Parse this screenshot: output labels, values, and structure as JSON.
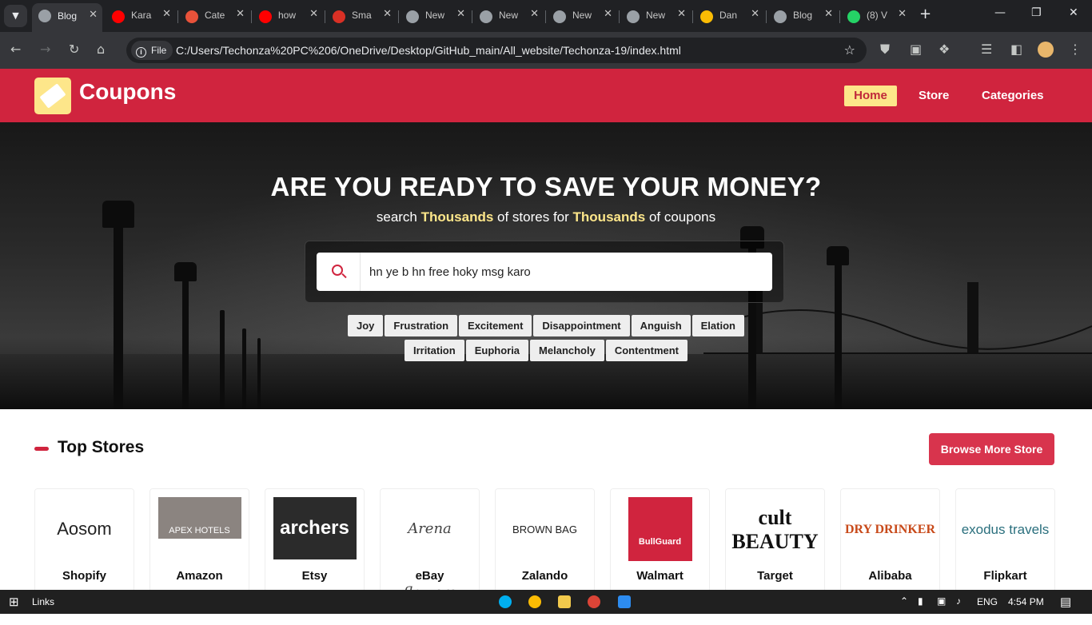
{
  "browser": {
    "tabs": [
      {
        "title": "Blog",
        "active": true,
        "color": "#9aa0a6"
      },
      {
        "title": "Kara",
        "active": false,
        "color": "#ff0000"
      },
      {
        "title": "Cate",
        "active": false,
        "color": "#e8523a"
      },
      {
        "title": "how",
        "active": false,
        "color": "#ff0000"
      },
      {
        "title": "Sma",
        "active": false,
        "color": "#d93025"
      },
      {
        "title": "New",
        "active": false,
        "color": "#9aa0a6"
      },
      {
        "title": "New",
        "active": false,
        "color": "#9aa0a6"
      },
      {
        "title": "New",
        "active": false,
        "color": "#9aa0a6"
      },
      {
        "title": "New",
        "active": false,
        "color": "#9aa0a6"
      },
      {
        "title": "Dan",
        "active": false,
        "color": "#fbbc04"
      },
      {
        "title": "Blog",
        "active": false,
        "color": "#9aa0a6"
      },
      {
        "title": "(8) V",
        "active": false,
        "color": "#25d366"
      }
    ],
    "new_tab_icon": "plus-icon",
    "file_chip": "File",
    "url": "C:/Users/Techonza%20PC%206/OneDrive/Desktop/GitHub_main/All_website/Techonza-19/index.html"
  },
  "site": {
    "logo_text": "Coupons",
    "nav": [
      "Home",
      "Store",
      "Categories"
    ],
    "hero": {
      "title": "ARE YOU READY TO SAVE YOUR MONEY?",
      "sub_1": "search",
      "sub_hl_1": "Thousands",
      "sub_2": "of stores for",
      "sub_hl_2": "Thousands",
      "sub_3": "of coupons",
      "search_value": "hn ye b hn free hoky msg karo",
      "tags_row1": [
        "Joy",
        "Frustration",
        "Excitement",
        "Disappointment",
        "Anguish",
        "Elation"
      ],
      "tags_row2": [
        "Irritation",
        "Euphoria",
        "Melancholy",
        "Contentment"
      ]
    },
    "top_stores": {
      "title": "Top Stores",
      "browse_label": "Browse More Store",
      "stores": [
        {
          "name": "Shopify",
          "logo": "Aosom"
        },
        {
          "name": "Amazon",
          "logo": "APEX HOTELS"
        },
        {
          "name": "Etsy",
          "logo": "archers"
        },
        {
          "name": "eBay",
          "logo": "Arena flowers"
        },
        {
          "name": "Zalando",
          "logo": "BROWN BAG"
        },
        {
          "name": "Walmart",
          "logo": "BullGuard"
        },
        {
          "name": "Target",
          "logo": "cult BEAUTY"
        },
        {
          "name": "Alibaba",
          "logo": "DRY DRINKER"
        },
        {
          "name": "Flipkart",
          "logo": "exodus travels"
        }
      ]
    }
  },
  "taskbar": {
    "links_label": "Links",
    "lang": "ENG",
    "time": "4:54 PM"
  },
  "colors": {
    "brand_red": "#d0243e",
    "accent_yellow": "#fde68a"
  }
}
